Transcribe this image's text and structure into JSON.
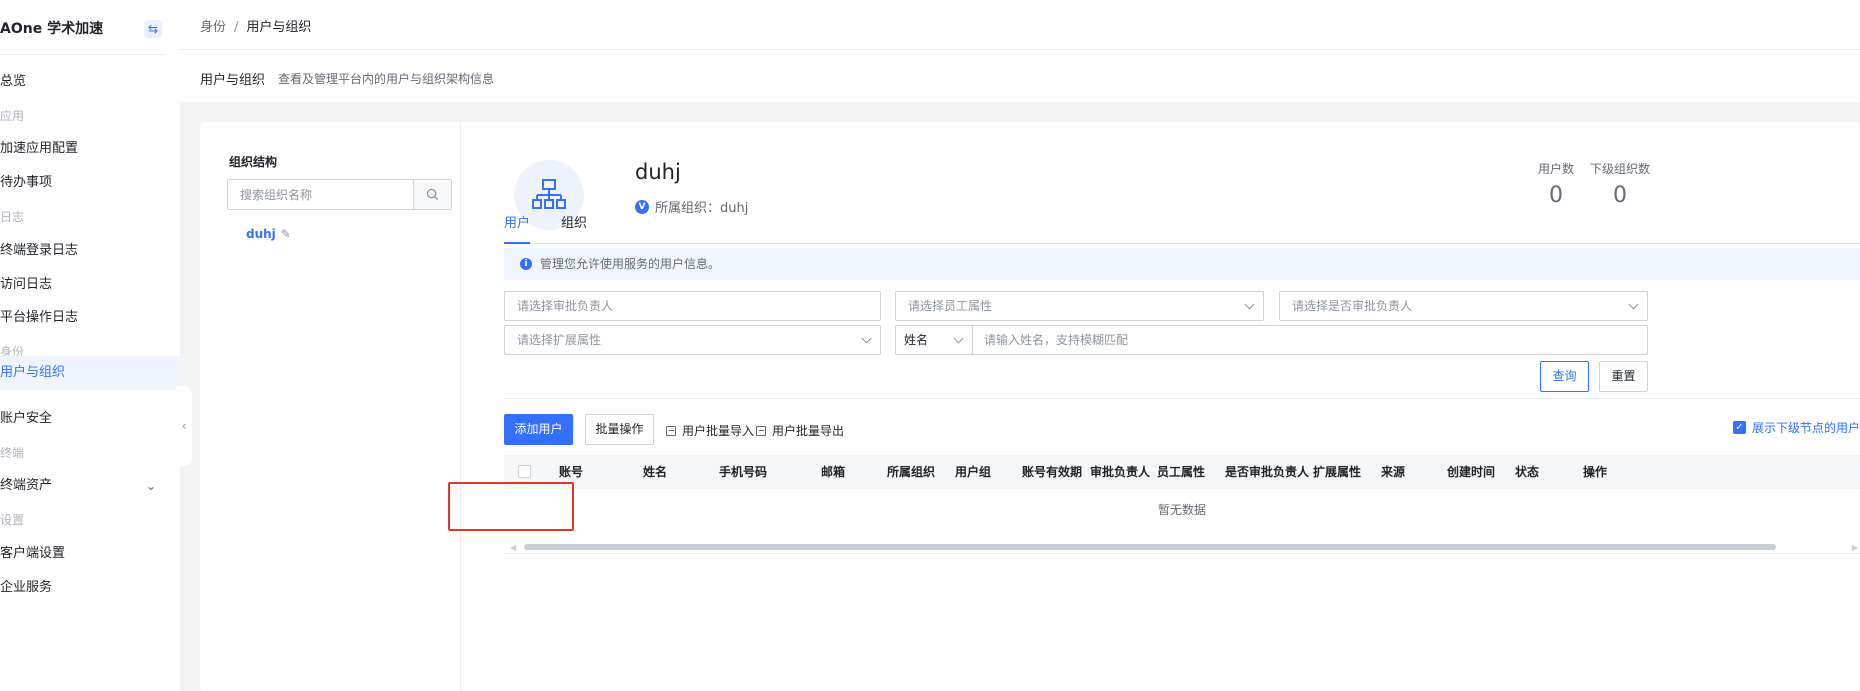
{
  "sidebar": {
    "brand": "AOne 学术加速",
    "toggle_icon": "⇆",
    "items": [
      {
        "label": "总览",
        "type": "item"
      },
      {
        "label": "应用",
        "type": "group"
      },
      {
        "label": "加速应用配置",
        "type": "item"
      },
      {
        "label": "待办事项",
        "type": "item"
      },
      {
        "label": "日志",
        "type": "group"
      },
      {
        "label": "终端登录日志",
        "type": "item"
      },
      {
        "label": "访问日志",
        "type": "item"
      },
      {
        "label": "平台操作日志",
        "type": "item"
      },
      {
        "label": "身份",
        "type": "group"
      },
      {
        "label": "用户与组织",
        "type": "item",
        "active": true
      },
      {
        "label": "账户安全",
        "type": "item"
      },
      {
        "label": "终端",
        "type": "group"
      },
      {
        "label": "终端资产",
        "type": "item",
        "expandable": true
      },
      {
        "label": "设置",
        "type": "group"
      },
      {
        "label": "客户端设置",
        "type": "item"
      },
      {
        "label": "企业服务",
        "type": "item"
      }
    ]
  },
  "header": {
    "breadcrumb_parent": "身份",
    "breadcrumb_sep": "/",
    "breadcrumb_current": "用户与组织",
    "page_title": "用户与组织",
    "page_desc": "查看及管理平台内的用户与组织架构信息"
  },
  "org_panel": {
    "title": "组织结构",
    "search_placeholder": "搜索组织名称",
    "node_label": "duhj",
    "edit_icon": "✎"
  },
  "org_info": {
    "name": "duhj",
    "parent_badge": "V",
    "parent_text": "所属组织：duhj",
    "stats": [
      {
        "label": "用户数",
        "value": "0"
      },
      {
        "label": "下级组织数",
        "value": "0"
      }
    ]
  },
  "tabs": [
    {
      "label": "用户",
      "active": true
    },
    {
      "label": "组织",
      "active": false
    }
  ],
  "notice": {
    "icon": "i",
    "text": "管理您允许使用服务的用户信息。"
  },
  "filters": {
    "approver_placeholder": "请选择审批负责人",
    "employee_attr_placeholder": "请选择员工属性",
    "is_approver_placeholder": "请选择是否审批负责人",
    "ext_attr_placeholder": "请选择扩展属性",
    "search_field_select": "姓名",
    "search_placeholder": "请输入姓名，支持模糊匹配",
    "query_label": "查询",
    "reset_label": "重置"
  },
  "toolbar": {
    "add_user_label": "添加用户",
    "batch_label": "批量操作",
    "import_label": "用户批量导入",
    "export_label": "用户批量导出",
    "show_sub_label": "展示下级节点的用户",
    "show_sub_checked": "✓"
  },
  "table": {
    "columns": [
      "账号",
      "姓名",
      "手机号码",
      "邮箱",
      "所属组织",
      "用户组",
      "账号有效期",
      "审批负责人",
      "员工属性",
      "是否审批负责人",
      "扩展属性",
      "来源",
      "创建时间",
      "状态",
      "操作"
    ],
    "empty_text": "暂无数据",
    "scroll_left": "◀",
    "scroll_right": "▶"
  }
}
